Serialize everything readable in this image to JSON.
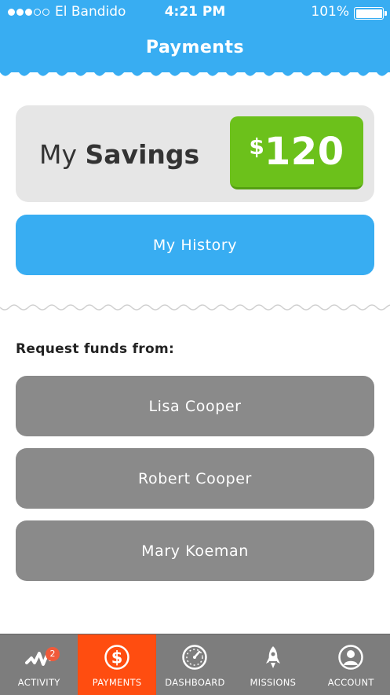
{
  "status_bar": {
    "carrier": "El Bandido",
    "time": "4:21 PM",
    "battery": "101%"
  },
  "header": {
    "title": "Payments"
  },
  "savings": {
    "label_prefix": "My",
    "label_strong": "Savings",
    "currency": "$",
    "amount": "120",
    "amount_color": "#6cc11b"
  },
  "history_button": {
    "label": "My History"
  },
  "request": {
    "title": "Request funds from:",
    "people": [
      "Lisa Cooper",
      "Robert Cooper",
      "Mary Koeman"
    ]
  },
  "tabbar": {
    "active_color": "#ff4d10",
    "tabs": [
      {
        "label": "ACTIVITY",
        "icon": "activity-icon",
        "badge": "2"
      },
      {
        "label": "PAYMENTS",
        "icon": "dollar-icon",
        "active": true
      },
      {
        "label": "DASHBOARD",
        "icon": "speedometer-icon"
      },
      {
        "label": "MISSIONS",
        "icon": "rocket-icon"
      },
      {
        "label": "ACCOUNT",
        "icon": "user-icon"
      }
    ]
  },
  "colors": {
    "brand_blue": "#38adf2",
    "button_gray": "#8a8a8a",
    "card_gray": "#e6e6e6"
  }
}
